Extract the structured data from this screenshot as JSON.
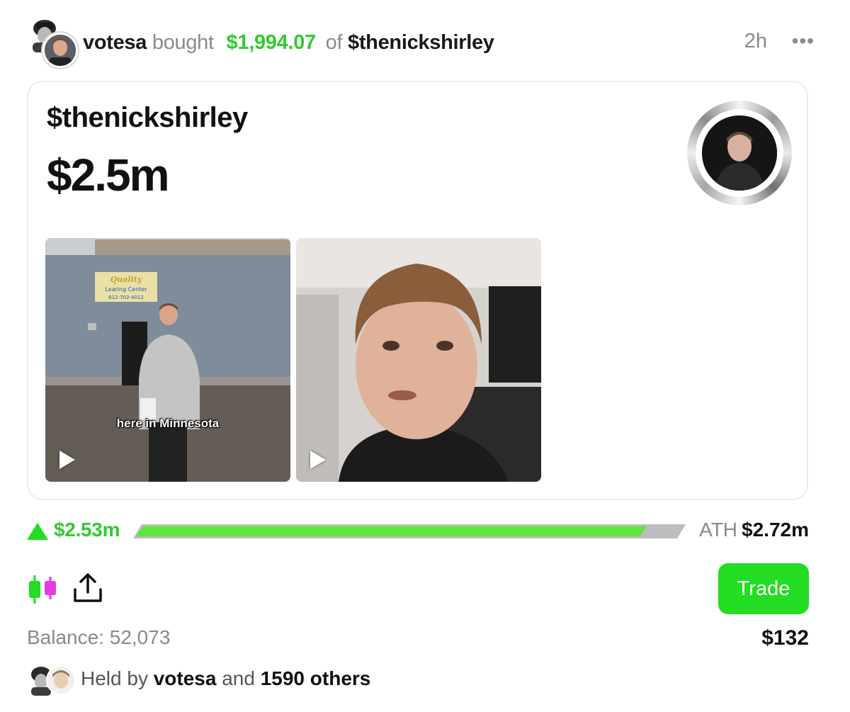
{
  "header": {
    "username": "votesa",
    "action": "bought",
    "amount": "$1,994.07",
    "preposition": "of",
    "ticker": "$thenickshirley",
    "time": "2h",
    "more": "•••"
  },
  "card": {
    "ticker": "$thenickshirley",
    "market_cap": "$2.5m",
    "videos": [
      {
        "caption": "here in Minnesota",
        "sign_text": "Quality Learing Center"
      },
      {
        "caption": ""
      }
    ]
  },
  "progress": {
    "current": "$2.53m",
    "ath_label": "ATH",
    "ath_value": "$2.72m",
    "fill_fraction": 0.93,
    "fill_color": "#5fe63a",
    "track_color": "#bdbdbd"
  },
  "actions": {
    "trade_label": "Trade",
    "balance": "Balance: 52,073",
    "trade_amount": "$132"
  },
  "holders": {
    "prefix": "Held by",
    "first": "votesa",
    "conjunction": "and",
    "others": "1590 others"
  },
  "icons": {
    "candle": "candlestick-icon",
    "share": "share-icon",
    "more": "more-dots-icon",
    "play": "play-icon",
    "up": "up-arrow-icon"
  },
  "colors": {
    "accent_green": "#22dd22",
    "money_green": "#2ecc2e",
    "candle_magenta": "#e63be6",
    "muted": "#8a8a8a"
  }
}
